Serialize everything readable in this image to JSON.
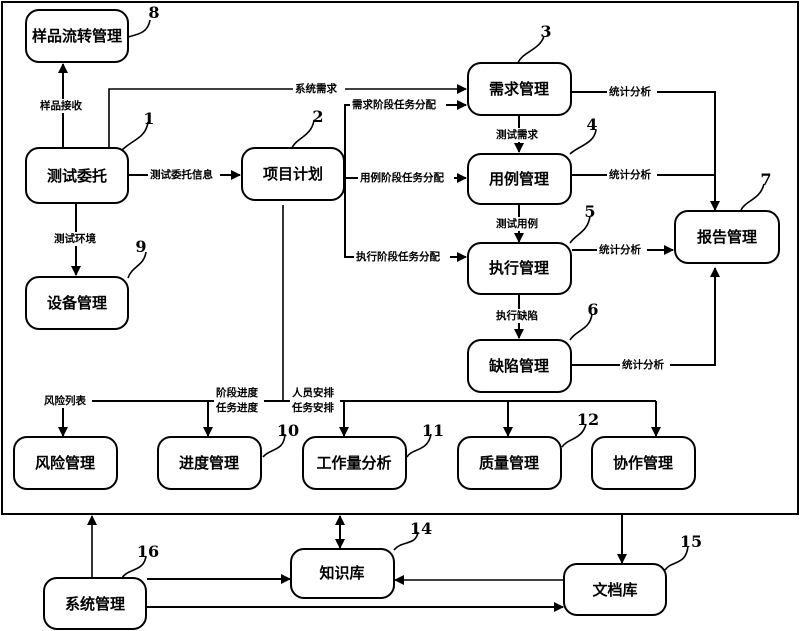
{
  "diagram": {
    "nodes": [
      {
        "id": "n8",
        "label": "样品流转管理",
        "ref": "8"
      },
      {
        "id": "n1",
        "label": "测试委托",
        "ref": "1"
      },
      {
        "id": "n9",
        "label": "设备管理",
        "ref": "9"
      },
      {
        "id": "n2",
        "label": "项目计划",
        "ref": "2"
      },
      {
        "id": "n3",
        "label": "需求管理",
        "ref": "3"
      },
      {
        "id": "n4",
        "label": "用例管理",
        "ref": "4"
      },
      {
        "id": "n5",
        "label": "执行管理",
        "ref": "5"
      },
      {
        "id": "n6",
        "label": "缺陷管理",
        "ref": "6"
      },
      {
        "id": "n7",
        "label": "报告管理",
        "ref": "7"
      },
      {
        "id": "risk",
        "label": "风险管理",
        "ref": ""
      },
      {
        "id": "n10",
        "label": "进度管理",
        "ref": "10"
      },
      {
        "id": "n11",
        "label": "工作量分析",
        "ref": "11"
      },
      {
        "id": "n12",
        "label": "质量管理",
        "ref": "12"
      },
      {
        "id": "collab",
        "label": "协作管理",
        "ref": ""
      },
      {
        "id": "n14",
        "label": "知识库",
        "ref": "14"
      },
      {
        "id": "n15",
        "label": "文档库",
        "ref": "15"
      },
      {
        "id": "n16",
        "label": "系统管理",
        "ref": "16"
      }
    ],
    "edges": {
      "sample_receive": "样品接收",
      "system_req": "系统需求",
      "test_commission_info": "测试委托信息",
      "test_env": "测试环境",
      "req_stage_task": "需求阶段任务分配",
      "case_stage_task": "用例阶段任务分配",
      "exec_stage_task": "执行阶段任务分配",
      "test_req": "测试需求",
      "test_case": "测试用例",
      "exec_defect": "执行缺陷",
      "stat_3": "统计分析",
      "stat_4": "统计分析",
      "stat_5": "统计分析",
      "stat_6": "统计分析",
      "risk_list": "风险列表",
      "stage_progress": "阶段进度",
      "task_progress": "任务进度",
      "staff_arrange": "人员安排",
      "task_arrange": "任务安排"
    }
  }
}
